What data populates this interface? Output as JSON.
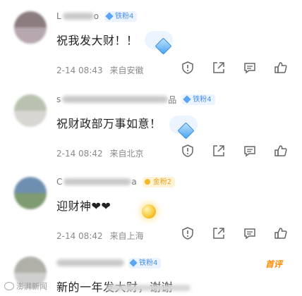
{
  "comments": [
    {
      "name_hint": "L",
      "name_suffix": "o",
      "badge": "铁粉4",
      "badge_type": "blue",
      "text": "祝我发大财！！",
      "sticker": "diamond-sticker",
      "time": "2-14 08:43",
      "location": "来自安徽",
      "avatar_colors": [
        "#8b7d7f",
        "#b7a8b0"
      ]
    },
    {
      "name_hint": "s",
      "name_suffix": "品",
      "badge": "铁粉4",
      "badge_type": "blue",
      "text": "祝财政部万事如意！",
      "sticker": "diamond-sticker",
      "time": "2-14 08:42",
      "location": "来自北京",
      "avatar_colors": [
        "#b9c2b0",
        "#d8d6d2"
      ]
    },
    {
      "name_hint": "C",
      "name_suffix": "a",
      "badge": "金粉2",
      "badge_type": "gold",
      "text": "迎财神❤❤",
      "sticker": "gold-coin-sticker",
      "time": "2-14 08:42",
      "location": "来自上海",
      "avatar_colors": [
        "#6f8fb0",
        "#7e9b72"
      ]
    },
    {
      "name_hint": "",
      "name_suffix": "",
      "badge": "铁粉4",
      "badge_type": "blue",
      "text": "新的一年发大财，谢谢",
      "selected_label": "首评",
      "avatar_colors": [
        "#b0b0a8",
        "#cfcfcf"
      ]
    }
  ],
  "actions": [
    "report-icon",
    "share-icon",
    "comment-icon",
    "like-icon"
  ],
  "watermark": {
    "text": "澎湃新闻"
  },
  "colors": {
    "badge_blue": "#4a90e8",
    "badge_gold": "#e5a21e",
    "meta_gray": "#8a8a8a",
    "selected_orange": "#ff8a00"
  }
}
